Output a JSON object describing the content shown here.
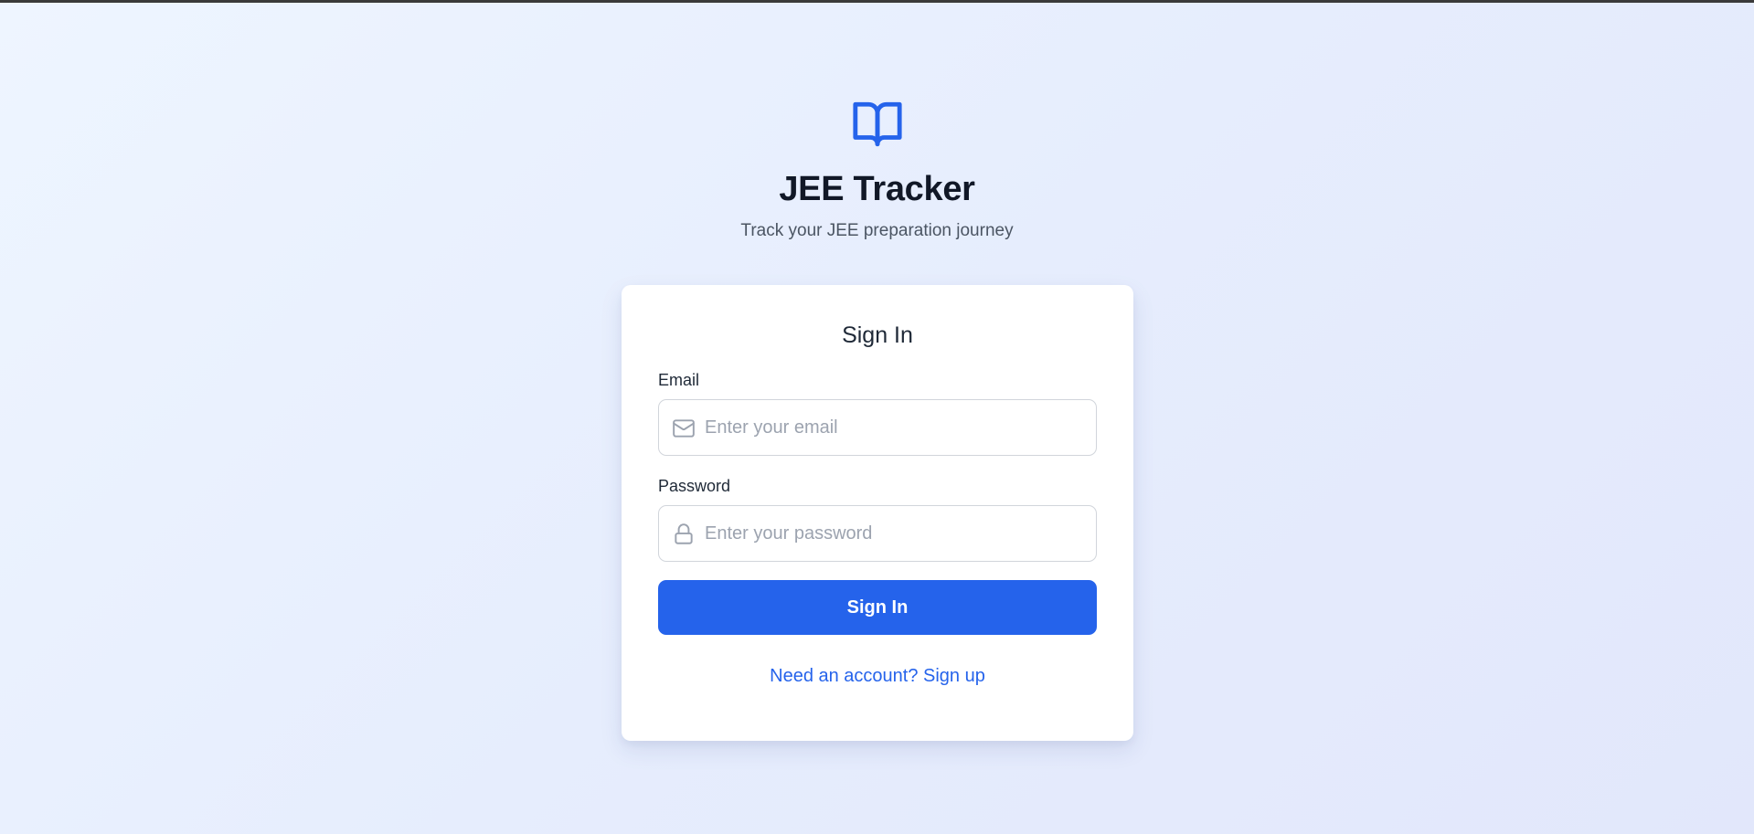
{
  "brand": {
    "logo_icon": "book-open-icon",
    "title": "JEE Tracker",
    "subtitle": "Track your JEE preparation journey"
  },
  "form": {
    "title": "Sign In",
    "email": {
      "label": "Email",
      "icon": "mail-icon",
      "value": "",
      "placeholder": "Enter your email"
    },
    "password": {
      "label": "Password",
      "icon": "lock-icon",
      "value": "",
      "placeholder": "Enter your password"
    },
    "submit_label": "Sign In",
    "signup_link": "Need an account? Sign up"
  },
  "colors": {
    "accent": "#2563eb",
    "background": "#e8eefc",
    "title_text": "#111827",
    "muted_text": "#4b5563",
    "placeholder": "#9ca3af"
  }
}
